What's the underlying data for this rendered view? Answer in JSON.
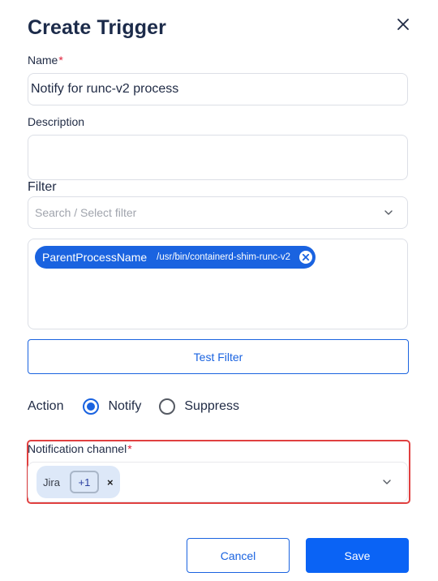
{
  "dialog": {
    "title": "Create Trigger",
    "close_icon": "close-icon"
  },
  "name": {
    "label": "Name",
    "required_mark": "*",
    "value": "Notify for runc-v2 process"
  },
  "description": {
    "label": "Description",
    "value": ""
  },
  "filter": {
    "label": "Filter",
    "placeholder": "Search / Select filter",
    "chips": [
      {
        "key": "ParentProcessName",
        "value": "/usr/bin/containerd-shim-runc-v2"
      }
    ]
  },
  "test_filter": {
    "label": "Test Filter"
  },
  "action": {
    "label": "Action",
    "options": [
      {
        "label": "Notify",
        "checked": true
      },
      {
        "label": "Suppress",
        "checked": false
      }
    ]
  },
  "notification_channel": {
    "label": "Notification channel",
    "required_mark": "*",
    "selected": "Jira",
    "more_count": "+1",
    "remove_glyph": "×"
  },
  "footer": {
    "cancel_label": "Cancel",
    "save_label": "Save"
  },
  "colors": {
    "primary": "#1a63e0",
    "save": "#0a63f5",
    "required": "#e0203a",
    "highlight": "#e04040"
  }
}
